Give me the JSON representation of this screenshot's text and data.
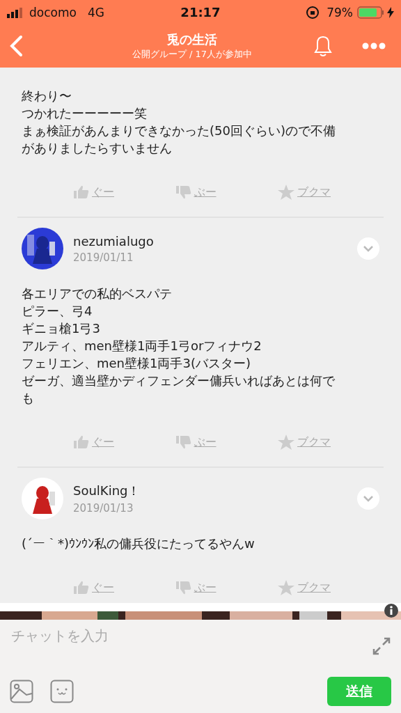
{
  "status_bar": {
    "carrier": "docomo",
    "network": "4G",
    "time": "21:17",
    "battery": "79%"
  },
  "header": {
    "title": "兎の生活",
    "subtitle": "公開グループ / 17人が参加中"
  },
  "posts": [
    {
      "body": [
        "終わり〜",
        "つかれたーーーーー笑",
        "まぁ検証があんまりできなかった(50回ぐらい)ので不備がありましたらすいません"
      ],
      "actions": [
        "ぐー",
        "ぶー",
        "ブクマ"
      ]
    },
    {
      "author": "nezumialugo",
      "date": "2019/01/11",
      "body": [
        "各エリアでの私的ベスパテ",
        "ピラー、弓4",
        "ギニョ槍1弓3",
        "アルティ、men壁様1両手1弓orフィナウ2",
        "フェリエン、men壁様1両手3(バスター)",
        "ゼーガ、適当壁かディフェンダー傭兵いればあとは何でも"
      ],
      "actions": [
        "ぐー",
        "ぶー",
        "ブクマ"
      ]
    },
    {
      "author": "SoulKing！",
      "date": "2019/01/13",
      "body": [
        "(´ー｀*)ｳﾝｳﾝ私の傭兵役にたってるやんw"
      ],
      "actions": [
        "ぐー",
        "ぶー",
        "ブクマ"
      ]
    }
  ],
  "composer": {
    "placeholder": "チャットを入力",
    "send": "送信"
  }
}
